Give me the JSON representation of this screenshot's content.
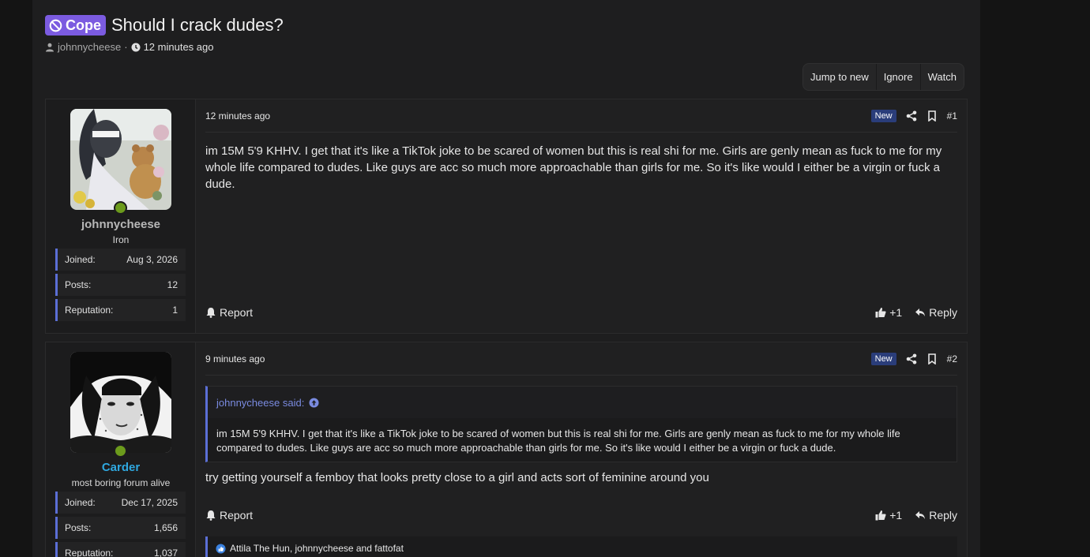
{
  "thread": {
    "prefix": "Cope",
    "title": "Should I crack dudes?",
    "author": "johnnycheese",
    "separator": "·",
    "time": "12 minutes ago"
  },
  "actions": {
    "jump": "Jump to new",
    "ignore": "Ignore",
    "watch": "Watch"
  },
  "labels": {
    "joined": "Joined:",
    "posts": "Posts:",
    "reputation": "Reputation:",
    "new": "New",
    "report": "Report",
    "reply": "Reply"
  },
  "colors": {
    "prefix": "#7b5be0",
    "accent": "#5b6fd6",
    "online": "#6c9b1c",
    "staff_name": "#2fa8e0"
  },
  "posts": [
    {
      "username": "johnnycheese",
      "user_title": "Iron",
      "joined": "Aug 3, 2026",
      "posts": "12",
      "reputation": "1",
      "date": "12 minutes ago",
      "number": "#1",
      "body": "im 15M 5'9 KHHV. I get that it's like a TikTok joke to be scared of women but this is real shi for me. Girls are genly mean as fuck to me for my whole life compared to dudes. Like guys are acc so much more approachable than girls for me. So it's like would I either be a virgin or fuck a dude.",
      "likes": "+1"
    },
    {
      "username": "Carder",
      "user_title": "most boring forum alive",
      "joined": "Dec 17, 2025",
      "posts": "1,656",
      "reputation": "1,037",
      "date": "9 minutes ago",
      "number": "#2",
      "quote_author": "johnnycheese said:",
      "quote_body": "im 15M 5'9 KHHV. I get that it's like a TikTok joke to be scared of women but this is real shi for me. Girls are genly mean as fuck to me for my whole life compared to dudes. Like guys are acc so much more approachable than girls for me. So it's like would I either be a virgin or fuck a dude.",
      "body": "try getting yourself a femboy that looks pretty close to a girl and acts sort of feminine around you",
      "likes": "+1",
      "reactions": "Attila The Hun, johnnycheese and fattofat"
    }
  ]
}
